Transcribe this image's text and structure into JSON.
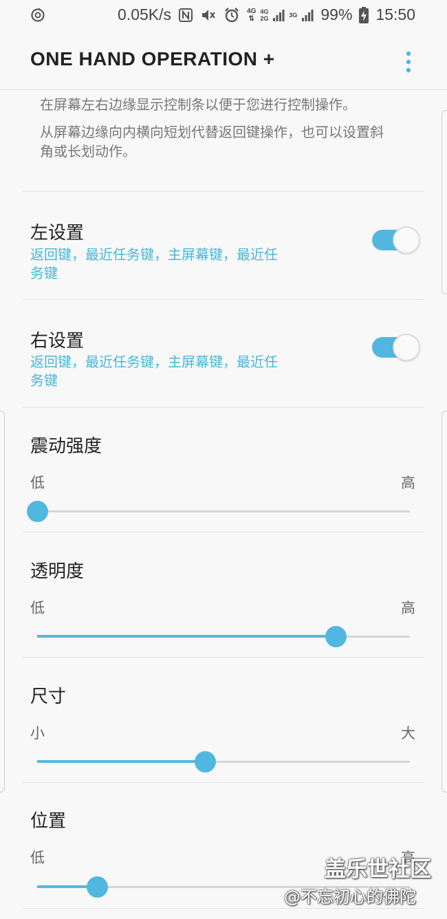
{
  "status_bar": {
    "net_speed": "0.05K/s",
    "battery": "99%",
    "time": "15:50",
    "icons": [
      "sync-icon",
      "nfc-icon",
      "mute-icon",
      "alarm-icon",
      "4g-data-icon",
      "signal-icon",
      "signal-icon-2",
      "battery-charging-icon"
    ],
    "net_label_1": "4G",
    "net_label_2": "4G",
    "net_label_3": "2G",
    "net_label_4": "3G"
  },
  "app_bar": {
    "title": "ONE HAND OPERATION +",
    "more_icon": "more-vert-icon"
  },
  "description": {
    "line1": "在屏幕左右边缘显示控制条以便于您进行控制操作。",
    "line2": "从屏幕边缘向内横向短划代替返回键操作，也可以设置斜角或长划动作。"
  },
  "left_settings": {
    "title": "左设置",
    "summary": "返回键，最近任务键，主屏幕键，最近任务键",
    "enabled": true
  },
  "right_settings": {
    "title": "右设置",
    "summary": "返回键，最近任务键，主屏幕键，最近任务键",
    "enabled": true
  },
  "sliders": [
    {
      "title": "震动强度",
      "min_label": "低",
      "max_label": "高",
      "value": 0.0
    },
    {
      "title": "透明度",
      "min_label": "低",
      "max_label": "高",
      "value": 0.8
    },
    {
      "title": "尺寸",
      "min_label": "小",
      "max_label": "大",
      "value": 0.45
    },
    {
      "title": "位置",
      "min_label": "低",
      "max_label": "高",
      "value": 0.16
    }
  ],
  "watermark": {
    "line1": "盖乐世社区",
    "line2": "@不忘初心的佛陀"
  },
  "colors": {
    "accent": "#52b7e0",
    "summary_text": "#46b8da"
  }
}
